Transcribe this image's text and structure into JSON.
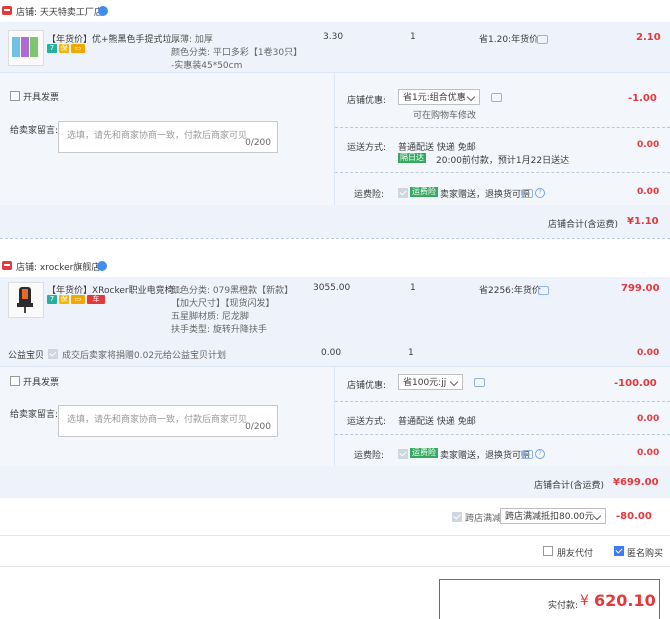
{
  "shop1": {
    "label": "店铺:",
    "name": "天天特卖工厂店",
    "item": {
      "title": "【年货价】优+熊黑色手提式垃...",
      "spec1": "厚薄: 加厚",
      "spec2": "颜色分类: 平口多彩【1卷30只】",
      "spec3": "-实惠装45*50cm",
      "price": "3.30",
      "qty": "1",
      "save": "省1.20:年货价",
      "subtotal": "2.10"
    },
    "same_ship": "开具发票",
    "msg_label": "给卖家留言:",
    "msg_placeholder": "选填，请先和商家协商一致，付款后商家可见",
    "msg_count": "0/200",
    "promo_label": "店铺优惠:",
    "promo_select": "省1元:组合优惠",
    "promo_note": "可在购物车修改",
    "promo_amount": "-1.00",
    "ship_label": "运送方式:",
    "ship_method": "普通配送 快递 免邮",
    "ship_tag": "隔日达",
    "ship_note": "20:00前付款，预计1月22日送达",
    "ship_amount": "0.00",
    "ins_label": "运费险:",
    "ins_tag": "运费险",
    "ins_text": "卖家赠送，退换货可赔",
    "ins_amount": "0.00",
    "total_label": "店铺合计(含运费)",
    "total": "¥1.10"
  },
  "shop2": {
    "label": "店铺:",
    "name": "xrocker旗舰店",
    "item": {
      "title": "【年货价】XRocker职业电竞椅...",
      "spec1": "颜色分类: 079黑橙款【新款】",
      "spec2": "【加大尺寸】【现货闪发】",
      "spec3": "五星脚材质: 尼龙脚",
      "spec4": "扶手类型: 旋转升降扶手",
      "price": "3055.00",
      "qty": "1",
      "save": "省2256:年货价",
      "subtotal": "799.00"
    },
    "charity_label": "公益宝贝",
    "charity_text": "成交后卖家将捐赠0.02元给公益宝贝计划",
    "charity_price": "0.00",
    "charity_qty": "1",
    "charity_sub": "0.00",
    "same_ship": "开具发票",
    "msg_label": "给卖家留言:",
    "msg_placeholder": "选填，请先和商家协商一致，付款后商家可见",
    "msg_count": "0/200",
    "promo_label": "店铺优惠:",
    "promo_select": "省100元:jj",
    "promo_amount": "-100.00",
    "ship_label": "运送方式:",
    "ship_method": "普通配送 快递 免邮",
    "ship_amount": "0.00",
    "ins_label": "运费险:",
    "ins_tag": "运费险",
    "ins_text": "卖家赠送，退换货可赔",
    "ins_amount": "0.00",
    "total_label": "店铺合计(含运费)",
    "total": "¥699.00"
  },
  "cross": {
    "label": "跨店满减",
    "select": "跨店满减抵扣80.00元",
    "amount": "-80.00"
  },
  "friend_pay": "朋友代付",
  "anon": "匿名购买",
  "pay": {
    "label": "实付款:",
    "currency": "¥",
    "amount": "620.10"
  },
  "colors": {
    "accent": "#e4393c",
    "blue": "#3d7cf0",
    "row_bg": "#eef3fb"
  }
}
